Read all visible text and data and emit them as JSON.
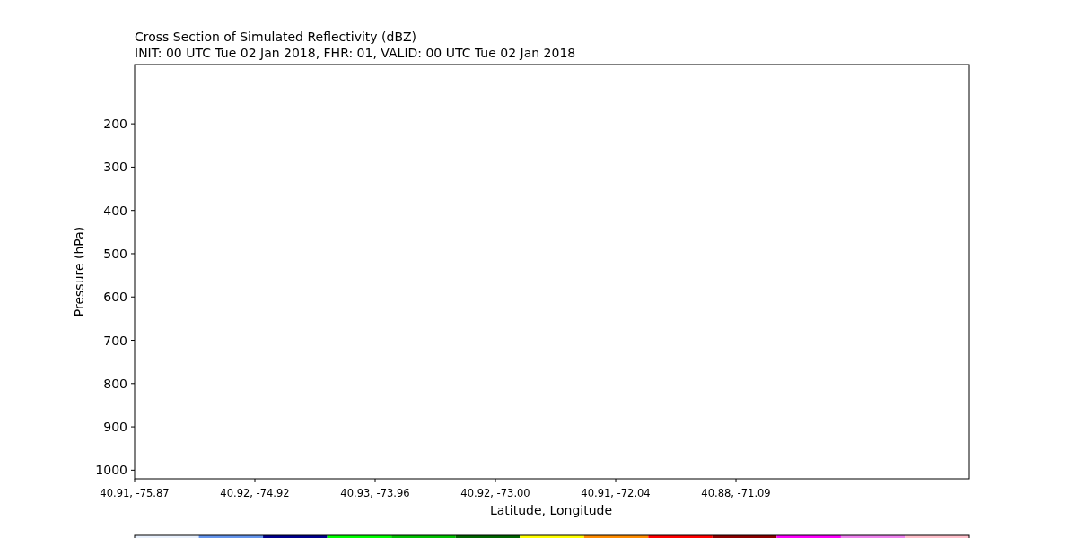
{
  "figure": {
    "title": "Cross Section of Simulated Reflectivity (dBZ)",
    "subtitle": "INIT: 00 UTC Tue 02 Jan 2018, FHR: 01, VALID: 00 UTC Tue 02 Jan 2018",
    "chart_data": {
      "type": "line",
      "xlabel": "Latitude, Longitude",
      "ylabel": "Pressure (hPa)",
      "ylim": [
        1020,
        63
      ],
      "categories": [
        "40.91, -75.87",
        "40.92, -74.92",
        "40.93, -73.96",
        "40.92, -73.00",
        "40.91, -72.04",
        "40.88, -71.09"
      ],
      "yticks": [
        200,
        300,
        400,
        500,
        600,
        700,
        800,
        900,
        1000
      ]
    },
    "colorbar": [
      {
        "color": "#e8f0fc"
      },
      {
        "color": "#6495ed"
      },
      {
        "color": "#00008b"
      },
      {
        "color": "#00ff00"
      },
      {
        "color": "#00c000"
      },
      {
        "color": "#006400"
      },
      {
        "color": "#ffff00"
      },
      {
        "color": "#ff8c00"
      },
      {
        "color": "#ff0000"
      },
      {
        "color": "#8b0000"
      },
      {
        "color": "#ff00ff"
      },
      {
        "color": "#ee82ee"
      },
      {
        "color": "#ffc0cb"
      }
    ]
  }
}
